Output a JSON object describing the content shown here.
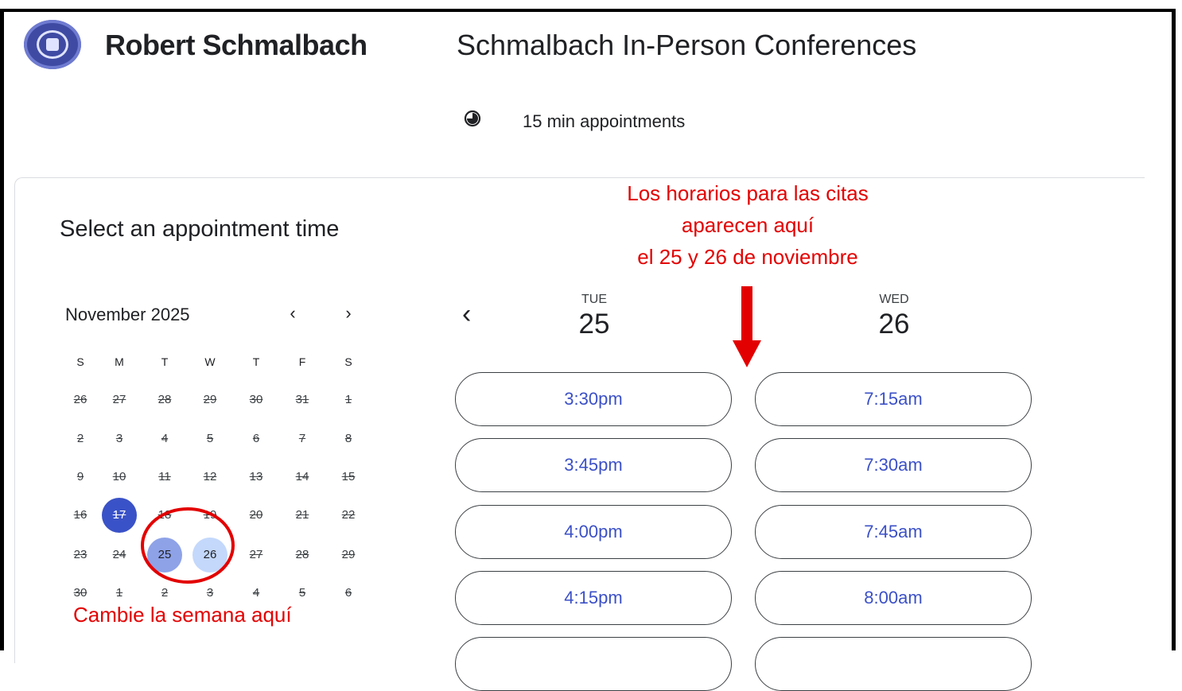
{
  "header": {
    "owner_name": "Robert Schmalbach",
    "page_title": "Schmalbach In-Person Conferences",
    "duration_label": "15 min appointments"
  },
  "booking": {
    "section_title": "Select an appointment time"
  },
  "calendar": {
    "month_label": "November 2025",
    "prev_month_glyph": "‹",
    "next_month_glyph": "›",
    "weekdays": [
      "S",
      "M",
      "T",
      "W",
      "T",
      "F",
      "S"
    ],
    "weeks": [
      [
        "26",
        "27",
        "28",
        "29",
        "30",
        "31",
        "1"
      ],
      [
        "2",
        "3",
        "4",
        "5",
        "6",
        "7",
        "8"
      ],
      [
        "9",
        "10",
        "11",
        "12",
        "13",
        "14",
        "15"
      ],
      [
        "16",
        "17",
        "18",
        "19",
        "20",
        "21",
        "22"
      ],
      [
        "23",
        "24",
        "25",
        "26",
        "27",
        "28",
        "29"
      ],
      [
        "30",
        "1",
        "2",
        "3",
        "4",
        "5",
        "6"
      ]
    ],
    "today": "17",
    "selected_week_days": [
      "25",
      "26"
    ]
  },
  "slots": {
    "prev_week_glyph": "‹",
    "columns": [
      {
        "weekday": "TUE",
        "date": "25",
        "times": [
          "3:30pm",
          "3:45pm",
          "4:00pm",
          "4:15pm"
        ]
      },
      {
        "weekday": "WED",
        "date": "26",
        "times": [
          "7:15am",
          "7:30am",
          "7:45am",
          "8:00am"
        ]
      }
    ]
  },
  "annotations": {
    "top_line1": "Los horarios para las citas",
    "top_line2": "aparecen aquí",
    "top_line3": "el 25 y 26 de noviembre",
    "bottom": "Cambie la semana aquí",
    "color": "#e30000"
  },
  "colors": {
    "accent": "#3a52c7",
    "slot_text": "#3b50c7",
    "selected_day_1": "#8ea2e8",
    "selected_day_2": "#c3d8fb"
  }
}
